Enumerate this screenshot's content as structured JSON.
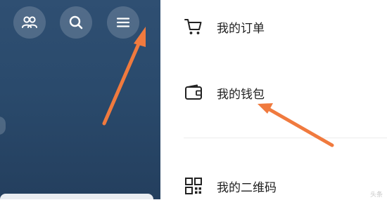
{
  "header": {
    "icons": [
      "friends-icon",
      "search-icon",
      "menu-icon"
    ]
  },
  "menu": {
    "items": [
      {
        "icon": "cart-icon",
        "label": "我的订单"
      },
      {
        "icon": "wallet-icon",
        "label": "我的钱包"
      },
      {
        "icon": "qr-code-icon",
        "label": "我的二维码"
      }
    ]
  },
  "colors": {
    "left_panel_top": "#2f4f72",
    "left_panel_bottom": "#243f5e",
    "annotation_arrow": "#f07a3e",
    "menu_text": "#1f1f1f"
  },
  "watermark": "头条"
}
